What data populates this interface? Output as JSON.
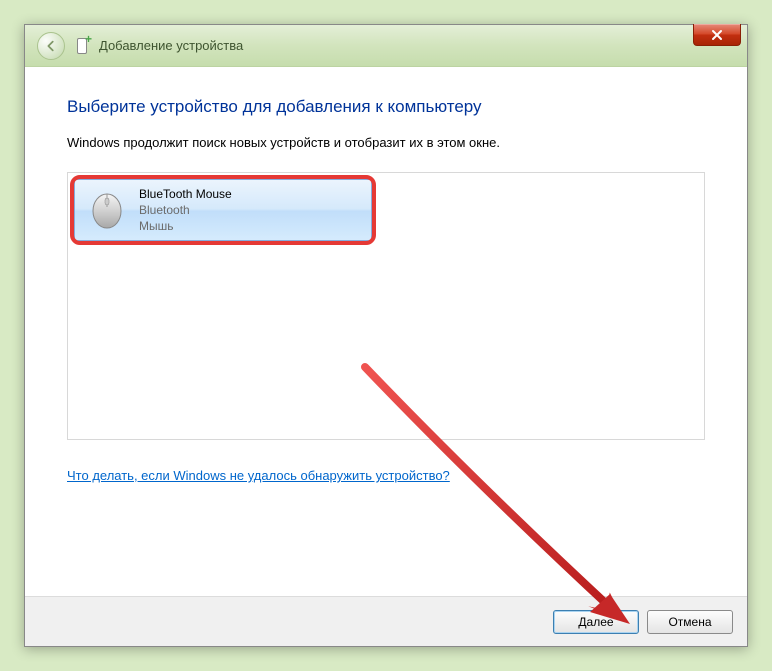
{
  "titlebar": {
    "title": "Добавление устройства"
  },
  "content": {
    "heading": "Выберите устройство для добавления к компьютеру",
    "subheading": "Windows продолжит поиск новых устройств и отобразит их в этом окне.",
    "help_link": "Что делать, если Windows не удалось обнаружить устройство?"
  },
  "devices": [
    {
      "name": "BlueTooth Mouse",
      "connection": "Bluetooth",
      "type": "Мышь"
    }
  ],
  "buttons": {
    "next": "Далее",
    "cancel": "Отмена"
  }
}
